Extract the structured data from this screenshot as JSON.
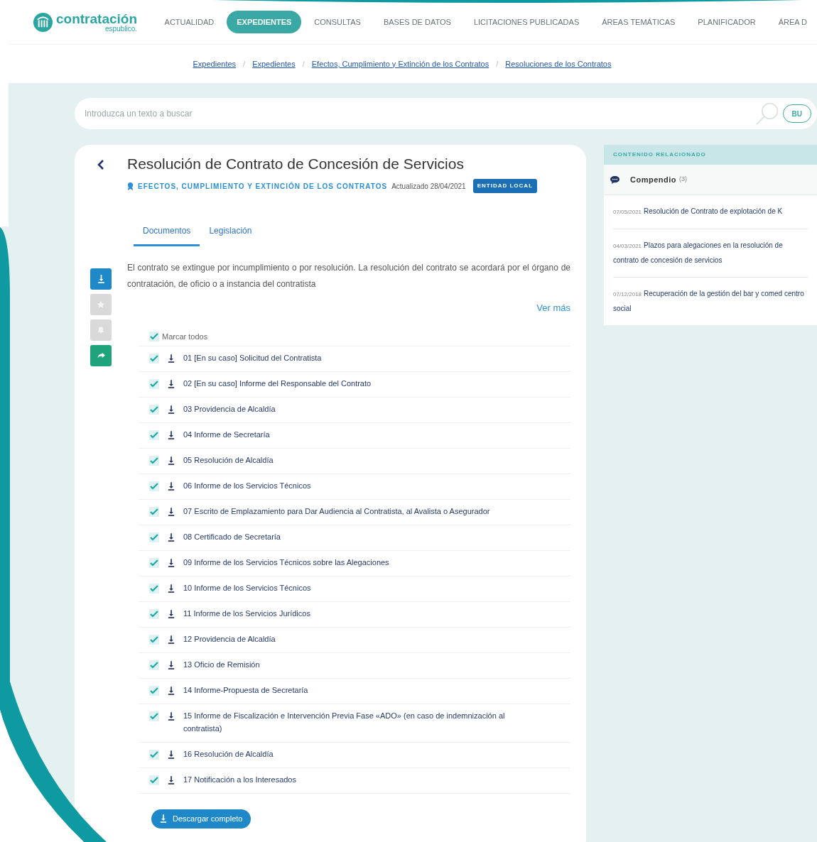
{
  "header": {
    "logo": {
      "name": "contratación",
      "sub": "espublico."
    },
    "nav": [
      {
        "label": "ACTUALIDAD",
        "selected": false
      },
      {
        "label": "EXPEDIENTES",
        "selected": true
      },
      {
        "label": "CONSULTAS",
        "selected": false
      },
      {
        "label": "BASES DE DATOS",
        "selected": false
      },
      {
        "label": "LICITACIONES PUBLICADAS",
        "selected": false
      },
      {
        "label": "ÁREAS TEMÁTICAS",
        "selected": false
      },
      {
        "label": "PLANIFICADOR",
        "selected": false
      },
      {
        "label": "ÁREA D",
        "selected": false
      }
    ]
  },
  "breadcrumb": {
    "separator": "/",
    "links": [
      "Expedientes",
      "Expedientes",
      "Efectos, Cumplimiento y Extinción de los Contratos",
      "Resoluciones de los Contratos"
    ]
  },
  "search": {
    "placeholder": "Introduzca un texto a buscar",
    "button": "BU"
  },
  "document": {
    "title": "Resolución de Contrato de Concesión de Servicios",
    "category": "EFECTOS, CUMPLIMIENTO Y EXTINCIÓN DE LOS CONTRATOS",
    "updated": "Actualizado 28/04/2021",
    "badge": "ENTIDAD LOCAL",
    "tabs": [
      {
        "label": "Documentos",
        "selected": true
      },
      {
        "label": "Legislación",
        "selected": false
      }
    ],
    "actions": [
      {
        "kind": "download",
        "disabled": false
      },
      {
        "kind": "favorite",
        "disabled": true
      },
      {
        "kind": "alert",
        "disabled": true
      },
      {
        "kind": "share",
        "disabled": false
      }
    ],
    "description": "El contrato se extingue por incumplimiento o por resolución. La resolución del contrato se acordará por el órgano de contratación, de oficio o a instancia del contratista",
    "more": "Ver más",
    "select_all": {
      "label": "Marcar todos",
      "checked": true
    },
    "files": [
      {
        "label": "01 [En su caso] Solicitud del Contratista",
        "checked": true
      },
      {
        "label": "02 [En su caso] Informe del Responsable del Contrato",
        "checked": true
      },
      {
        "label": "03 Providencia de Alcaldía",
        "checked": true
      },
      {
        "label": "04 Informe de Secretaría",
        "checked": true
      },
      {
        "label": "05 Resolución de Alcaldía",
        "checked": true
      },
      {
        "label": "06 Informe de los Servicios Técnicos",
        "checked": true
      },
      {
        "label": "07 Escrito de Emplazamiento para Dar Audiencia al Contratista, al Avalista o Asegurador",
        "checked": true
      },
      {
        "label": "08 Certificado de Secretaría",
        "checked": true
      },
      {
        "label": "09 Informe de los Servicios Técnicos sobre las Alegaciones",
        "checked": true
      },
      {
        "label": "10 Informe de los Servicios Técnicos",
        "checked": true
      },
      {
        "label": "11 Informe de los Servicios Jurídicos",
        "checked": true
      },
      {
        "label": "12 Providencia de Alcaldía",
        "checked": true
      },
      {
        "label": "13 Oficio de Remisión",
        "checked": true
      },
      {
        "label": "14 Informe-Propuesta de Secretaría",
        "checked": true
      },
      {
        "label": "15 Informe de Fiscalización e Intervención Previa Fase «ADO» (en caso de indemnización al contratista)",
        "checked": true
      },
      {
        "label": "16 Resolución de Alcaldía",
        "checked": true
      },
      {
        "label": "17 Notificación a los Interesados",
        "checked": true
      }
    ],
    "download_all": "Descargar completo"
  },
  "related": {
    "heading": "CONTENIDO RELACIONADO",
    "section": "Compendio",
    "count": "(3)",
    "items": [
      {
        "date": "07/05/2021",
        "title": "Resolución de Contrato de explotación de K"
      },
      {
        "date": "04/03/2021",
        "title": "Plazos para alegaciones en la resolución de contrato de concesión de servicios"
      },
      {
        "date": "07/12/2018",
        "title": "Recuperación de la gestión del bar y comed centro social"
      }
    ]
  }
}
